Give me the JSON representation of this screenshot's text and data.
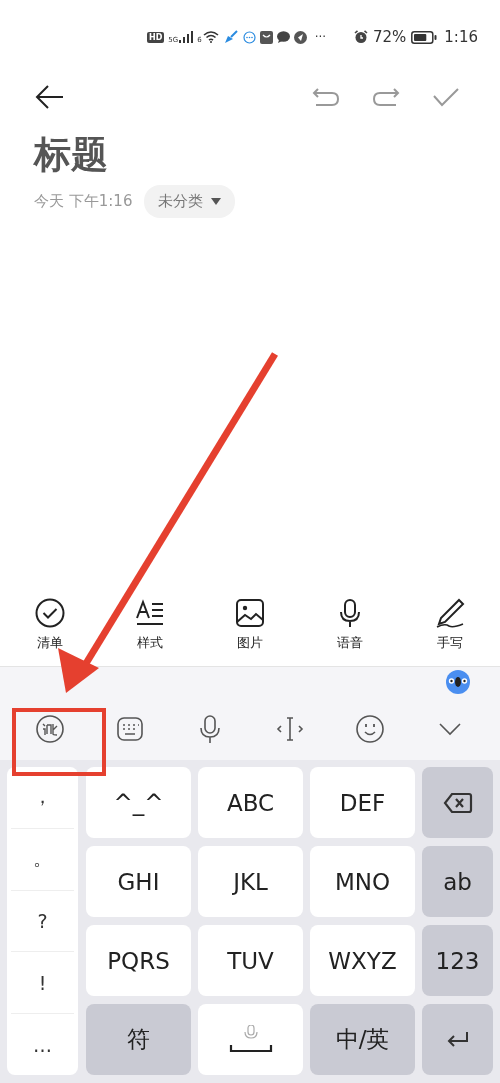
{
  "status_bar": {
    "hd_badge": "HD",
    "network": "5G",
    "wifi_label": "6",
    "more": "···",
    "battery": "72%",
    "time": "1:16"
  },
  "note": {
    "title": "标题",
    "date": "今天 下午1:16",
    "category": "未分类"
  },
  "toolbar": [
    {
      "kind": "checklist",
      "label": "清单"
    },
    {
      "kind": "style",
      "label": "样式"
    },
    {
      "kind": "image",
      "label": "图片"
    },
    {
      "kind": "voice",
      "label": "语音"
    },
    {
      "kind": "handwriting",
      "label": "手写"
    }
  ],
  "keyboard": {
    "tools": [
      {
        "kind": "logo"
      },
      {
        "kind": "keyboard"
      },
      {
        "kind": "mic"
      },
      {
        "kind": "cursor"
      },
      {
        "kind": "emoji"
      },
      {
        "kind": "collapse"
      }
    ],
    "symbols": [
      "，",
      "。",
      "?",
      "!",
      "…"
    ],
    "keys": [
      {
        "kind": "letter",
        "label": "^_^"
      },
      {
        "kind": "letter",
        "label": "ABC"
      },
      {
        "kind": "letter",
        "label": "DEF"
      },
      {
        "kind": "delete"
      },
      {
        "kind": "letter",
        "label": "GHI"
      },
      {
        "kind": "letter",
        "label": "JKL"
      },
      {
        "kind": "letter",
        "label": "MNO"
      },
      {
        "kind": "function",
        "label": "ab"
      },
      {
        "kind": "letter",
        "label": "PQRS"
      },
      {
        "kind": "letter",
        "label": "TUV"
      },
      {
        "kind": "letter",
        "label": "WXYZ"
      },
      {
        "kind": "function",
        "label": "123"
      },
      {
        "kind": "function",
        "label": "符"
      },
      {
        "kind": "space"
      },
      {
        "kind": "function",
        "label": "中/英"
      },
      {
        "kind": "enter"
      }
    ]
  },
  "annotation": {
    "kind": "arrow"
  }
}
